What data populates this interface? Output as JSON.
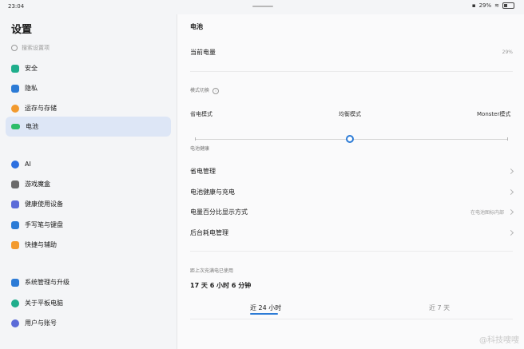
{
  "status_bar": {
    "time": "23:04",
    "battery_percent": "29%"
  },
  "sidebar": {
    "title": "设置",
    "search_placeholder": "搜索设置项",
    "items": [
      {
        "label": "安全",
        "icon": "shield-icon",
        "color": "#1fae8c"
      },
      {
        "label": "隐私",
        "icon": "privacy-icon",
        "color": "#2c7bd6"
      },
      {
        "label": "运存与存储",
        "icon": "storage-icon",
        "color": "#f29a2e"
      },
      {
        "label": "电池",
        "icon": "battery-icon",
        "color": "#2dbd6a",
        "active": true
      },
      {
        "label": "AI",
        "icon": "ai-icon",
        "color": "#2c6fe0"
      },
      {
        "label": "游戏魔盒",
        "icon": "gamepad-icon",
        "color": "#6a6a6a"
      },
      {
        "label": "健康使用设备",
        "icon": "hourglass-icon",
        "color": "#5b6bd8"
      },
      {
        "label": "手写笔与键盘",
        "icon": "pen-icon",
        "color": "#2c7bd6"
      },
      {
        "label": "快捷与辅助",
        "icon": "shortcut-icon",
        "color": "#f29a2e"
      },
      {
        "label": "系统管理与升级",
        "icon": "system-icon",
        "color": "#2c7bd6"
      },
      {
        "label": "关于平板电脑",
        "icon": "about-icon",
        "color": "#1fae8c"
      },
      {
        "label": "用户与账号",
        "icon": "user-icon",
        "color": "#5b6bd8"
      }
    ]
  },
  "main": {
    "title": "电池",
    "current_level_label": "当前电量",
    "current_level_value": "29%",
    "mode_switch_label": "模式切换",
    "modes": [
      "省电模式",
      "均衡模式",
      "Monster模式"
    ],
    "battery_protect_label": "电池健康",
    "settings": [
      {
        "label": "省电管理",
        "value": ""
      },
      {
        "label": "电池健康与充电",
        "value": ""
      },
      {
        "label": "电量百分比显示方式",
        "value": "在电池图标内部"
      },
      {
        "label": "后台耗电管理",
        "value": ""
      }
    ],
    "since_charge_label": "距上次充满电已使用",
    "since_charge_value": "17 天 6 小时 6 分钟",
    "tabs": [
      "近 24 小时",
      "近 7 天"
    ]
  },
  "watermark": "@科技嗖嗖"
}
